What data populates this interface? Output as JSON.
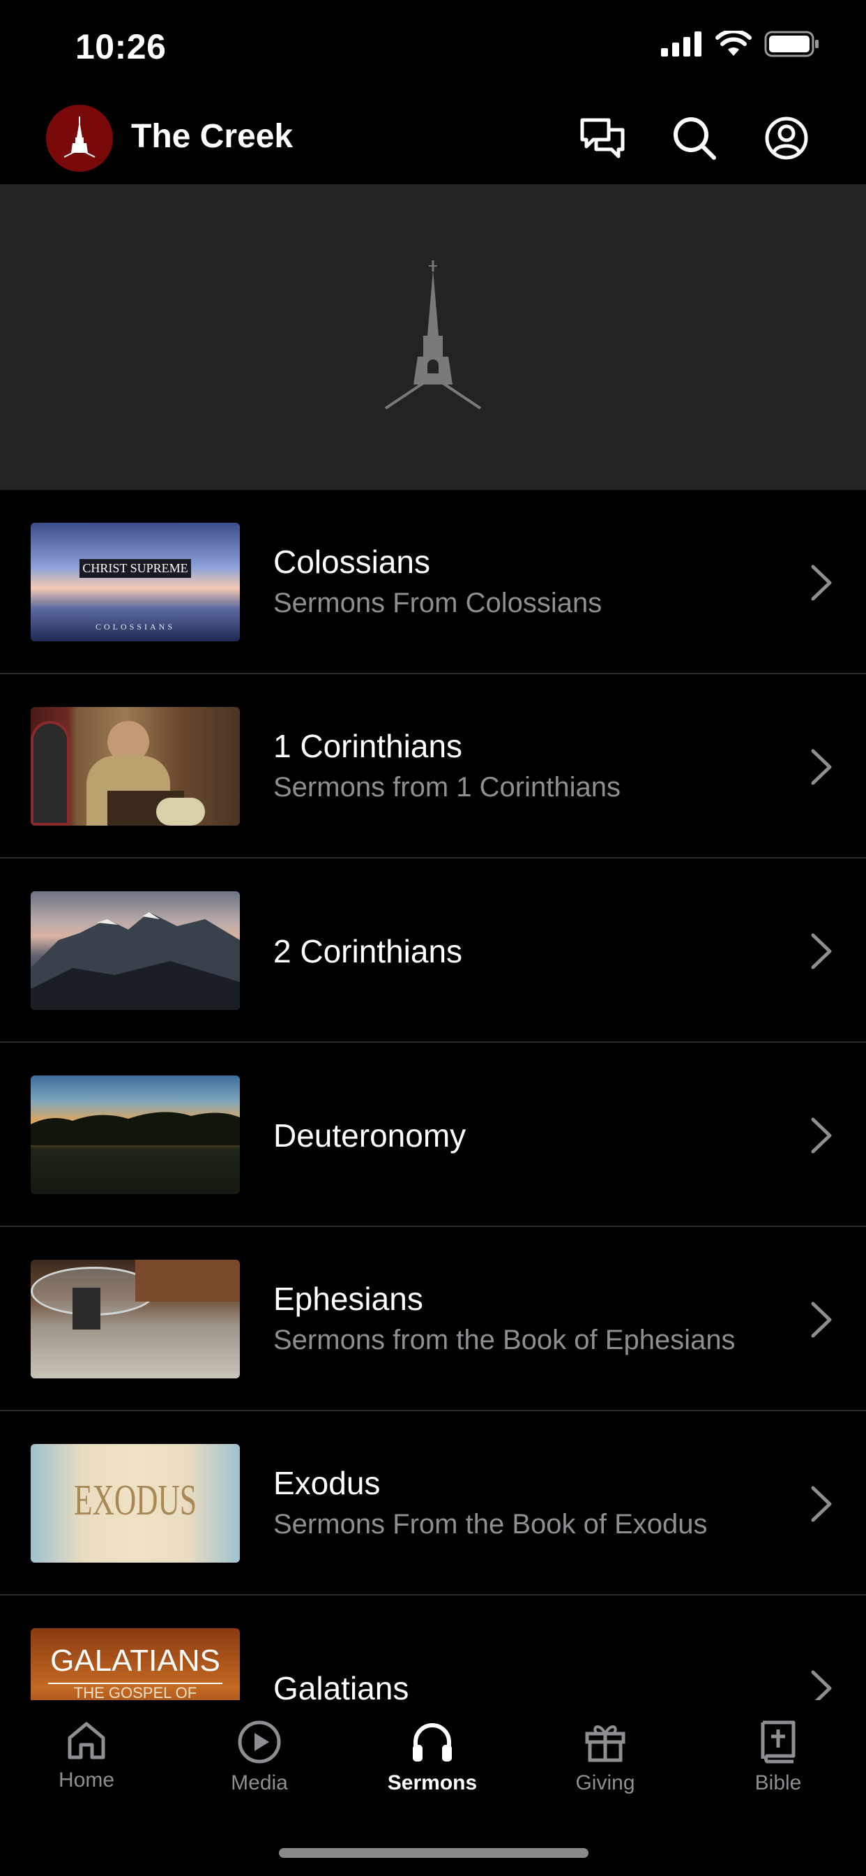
{
  "status_bar": {
    "time": "10:26"
  },
  "header": {
    "title": "The Creek"
  },
  "sermons": [
    {
      "title": "Colossians",
      "subtitle": "Sermons From Colossians",
      "thumb_title": "CHRIST SUPREME",
      "thumb_sub": "COLOSSIANS"
    },
    {
      "title": "1 Corinthians",
      "subtitle": "Sermons from 1 Corinthians"
    },
    {
      "title": "2 Corinthians",
      "subtitle": ""
    },
    {
      "title": "Deuteronomy",
      "subtitle": ""
    },
    {
      "title": "Ephesians",
      "subtitle": "Sermons from the Book of Ephesians"
    },
    {
      "title": "Exodus",
      "subtitle": "Sermons From the Book of Exodus",
      "thumb_title": "EXODUS"
    },
    {
      "title": "Galatians",
      "subtitle": "",
      "thumb_title": "GALATIANS",
      "thumb_sub": "THE GOSPEL OF GRACE"
    }
  ],
  "tabs": [
    {
      "label": "Home",
      "icon": "home-icon",
      "active": false
    },
    {
      "label": "Media",
      "icon": "play-icon",
      "active": false
    },
    {
      "label": "Sermons",
      "icon": "headphones-icon",
      "active": true
    },
    {
      "label": "Giving",
      "icon": "gift-icon",
      "active": false
    },
    {
      "label": "Bible",
      "icon": "bible-icon",
      "active": false
    }
  ],
  "colors": {
    "accent": "#7a0a0a",
    "banner_bg": "#232323",
    "secondary_text": "#8e8e93"
  }
}
